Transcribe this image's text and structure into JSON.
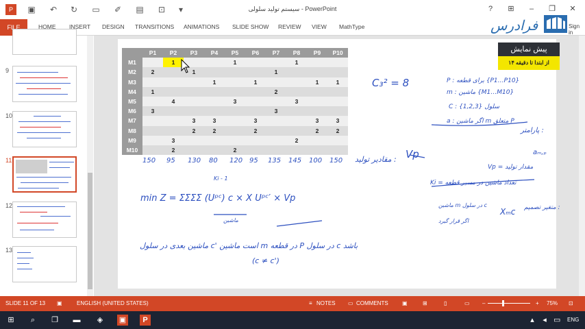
{
  "window": {
    "title": "سیستم تولید سلولی - PowerPoint",
    "help": "?"
  },
  "ribbon": {
    "tabs": [
      "FILE",
      "HOME",
      "INSERT",
      "DESIGN",
      "TRANSITIONS",
      "ANIMATIONS",
      "SLIDE SHOW",
      "REVIEW",
      "VIEW",
      "MathType"
    ],
    "signin": "Sign in"
  },
  "logo": {
    "text": "فرادرس"
  },
  "slides_panel": {
    "numbers": [
      "9",
      "10",
      "11",
      "12",
      "13"
    ],
    "active": "11"
  },
  "notice": {
    "heading": "پیش نمایش",
    "sub": "از ابتدا تا دقیقه ۱۴"
  },
  "table": {
    "columns": [
      "",
      "P1",
      "P2",
      "P3",
      "P4",
      "P5",
      "P6",
      "P7",
      "P8",
      "P9",
      "P10"
    ],
    "rows": [
      [
        "M1",
        "",
        "1",
        "",
        "",
        "1",
        "",
        "",
        "1",
        "",
        ""
      ],
      [
        "M2",
        "2",
        "",
        "1",
        "",
        "",
        "",
        "1",
        "",
        "",
        ""
      ],
      [
        "M3",
        "",
        "",
        "",
        "1",
        "",
        "1",
        "",
        "",
        "1",
        "1"
      ],
      [
        "M4",
        "1",
        "",
        "",
        "",
        "",
        "",
        "2",
        "",
        "",
        ""
      ],
      [
        "M5",
        "",
        "4",
        "",
        "",
        "3",
        "",
        "",
        "3",
        "",
        ""
      ],
      [
        "M6",
        "3",
        "",
        "",
        "",
        "",
        "",
        "3",
        "",
        "",
        ""
      ],
      [
        "M7",
        "",
        "",
        "3",
        "3",
        "",
        "3",
        "",
        "",
        "3",
        "3"
      ],
      [
        "M8",
        "",
        "",
        "2",
        "2",
        "",
        "2",
        "",
        "",
        "2",
        "2"
      ],
      [
        "M9",
        "",
        "3",
        "",
        "",
        "",
        "",
        "",
        "2",
        "",
        ""
      ],
      [
        "M10",
        "",
        "2",
        "",
        "",
        "2",
        "",
        "",
        "",
        "",
        ""
      ]
    ]
  },
  "handwriting": {
    "demand": [
      "150",
      "95",
      "130",
      "80",
      "120",
      "95",
      "135",
      "145",
      "100",
      "150"
    ],
    "demand_label": "مقادیر تولید :",
    "vp": "Vp",
    "eq1": "C₃² = 8",
    "def_p": "P : برای قطعه {P1…P10}",
    "def_m": "m : ماشین {M1…M10}",
    "def_c": "C : سلول {1,2,3}",
    "def_a": "a : اگر ماشین m متعلق P",
    "params": "پارامتر :",
    "objective": "min Z = ΣΣΣΣ (Uᵖᶜ) c × X Uᵖᶜ′ × Vp",
    "ki": "Ki - 1",
    "note_vp": "Vp = مقدار تولید",
    "note_ki": "Ki = تعداد ماشین در مسیر قطعه",
    "note_ap": "aₘ,ₚ",
    "var_label": "متغیر تصمیم :",
    "var_x": "Xₘc",
    "var_desc": "ماشین m در سلول c",
    "bin": "اگر قرار گیرد",
    "bottom_line": "ماشین بعدی در سلول c' است  ماشین m در قطعه P در سلول c باشد",
    "cc": "(c ≠ c')",
    "mashin": "ماشین"
  },
  "status": {
    "slide": "SLIDE 11 OF 13",
    "lang": "ENGLISH (UNITED STATES)",
    "notes": "NOTES",
    "comments": "COMMENTS",
    "zoom": "75%"
  },
  "taskbar": {
    "lang": "ENG"
  }
}
